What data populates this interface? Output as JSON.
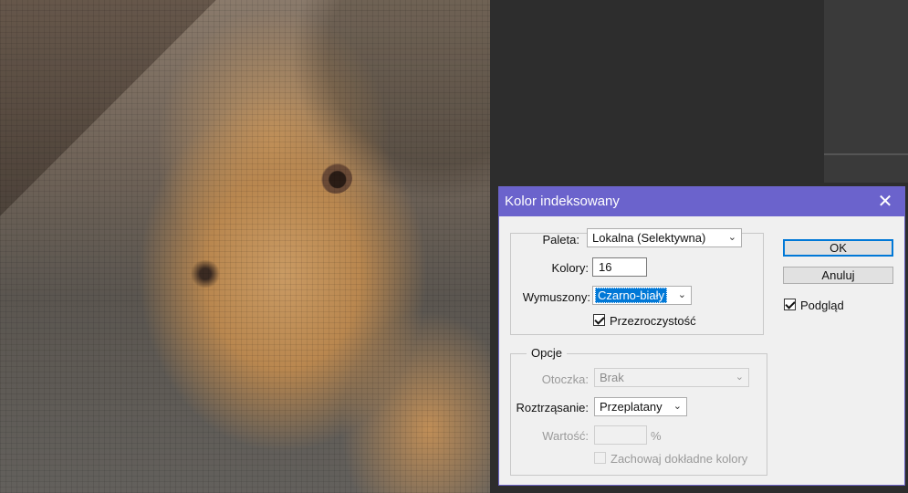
{
  "dialog": {
    "title": "Kolor indeksowany",
    "close_icon": "close-icon",
    "palette_group": {
      "paleta_label": "Paleta:",
      "paleta_value": "Lokalna (Selektywna)",
      "kolory_label": "Kolory:",
      "kolory_value": "16",
      "wymuszony_label": "Wymuszony:",
      "wymuszony_value": "Czarno-biały",
      "przezroczystosc_label": "Przezroczystość",
      "przezroczystosc_checked": true
    },
    "options_group": {
      "legend": "Opcje",
      "otoczka_label": "Otoczka:",
      "otoczka_value": "Brak",
      "roztrzasanie_label": "Roztrząsanie:",
      "roztrzasanie_value": "Przeplatany",
      "wartosc_label": "Wartość:",
      "wartosc_value": "",
      "wartosc_unit": "%",
      "zachowaj_label": "Zachowaj dokładne kolory",
      "zachowaj_checked": false
    },
    "buttons": {
      "ok": "OK",
      "cancel": "Anuluj"
    },
    "preview_label": "Podgląd",
    "preview_checked": true
  },
  "colors": {
    "titlebar": "#6b63cc",
    "selection": "#0078d7",
    "dialog_bg": "#f0f0f0"
  }
}
